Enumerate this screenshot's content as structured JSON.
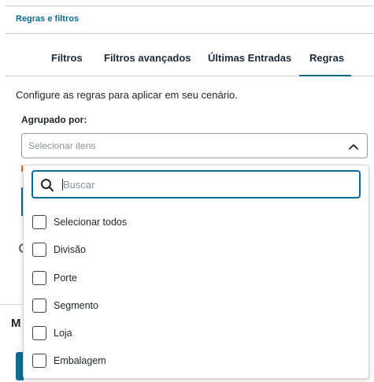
{
  "breadcrumb": "Regras e filtros",
  "tabs": [
    {
      "label": "Filtros"
    },
    {
      "label": "Filtros avançados"
    },
    {
      "label": "Últimas Entradas"
    },
    {
      "label": "Regras",
      "active": true
    }
  ],
  "description": "Configure as regras para aplicar em seu cenário.",
  "grouping": {
    "label": "Agrupado por:",
    "placeholder": "Selecionar itens"
  },
  "dropdown": {
    "search_placeholder": "Buscar",
    "options": [
      {
        "label": "Selecionar todos",
        "checked": false
      },
      {
        "label": "Divisão",
        "checked": false
      },
      {
        "label": "Porte",
        "checked": false
      },
      {
        "label": "Segmento",
        "checked": false
      },
      {
        "label": "Loja",
        "checked": false
      },
      {
        "label": "Embalagem",
        "checked": false
      }
    ]
  },
  "background": {
    "section_letter": "M"
  },
  "colors": {
    "accent": "#0c6c94",
    "warning": "#e2741b",
    "text": "#1d2426"
  }
}
